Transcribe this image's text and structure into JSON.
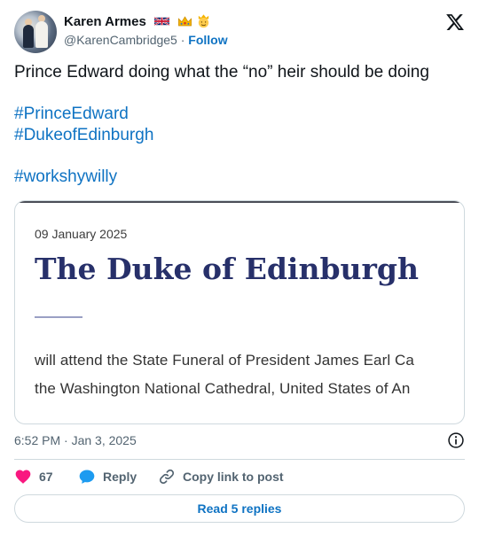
{
  "author": {
    "name": "Karen Armes",
    "handle": "@KarenCambridge5",
    "separator": "·",
    "follow_label": "Follow",
    "badges": [
      "uk-flag-icon",
      "crown-icon",
      "face-icon"
    ]
  },
  "tweet": {
    "text_line": "Prince Edward doing what the “no” heir should be doing",
    "hashtags": [
      "#PrinceEdward",
      "#DukeofEdinburgh",
      "#workshywilly"
    ],
    "timestamp": "6:52 PM · Jan 3, 2025"
  },
  "card": {
    "date": "09 January 2025",
    "title": "The Duke of Edinburgh",
    "line1": "will attend the State Funeral of President James Earl Ca",
    "line2": "the Washington National Cathedral, United States of An"
  },
  "actions": {
    "like_count": "67",
    "reply_label": "Reply",
    "copy_label": "Copy link to post"
  },
  "footer": {
    "read_replies_label": "Read 5 replies"
  },
  "colors": {
    "link": "#0f73c3",
    "heart": "#f91880",
    "reply_bubble": "#1d9bf0",
    "card_title": "#27306a",
    "muted": "#536471"
  }
}
